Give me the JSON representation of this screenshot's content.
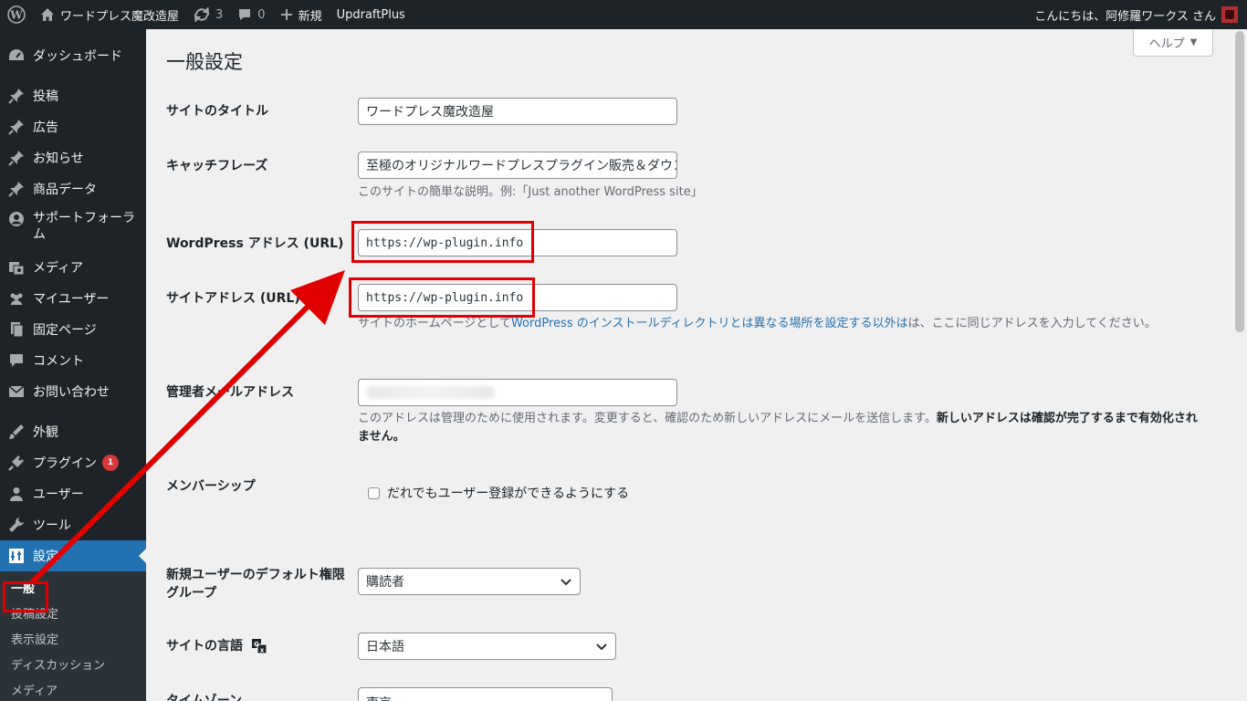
{
  "adminbar": {
    "site_name": "ワードプレス魔改造屋",
    "updates_count": "3",
    "comments_count": "0",
    "new_label": "新規",
    "plugin_label": "UpdraftPlus",
    "greeting": "こんにちは、阿修羅ワークス さん"
  },
  "sidebar": {
    "items": [
      {
        "label": "ダッシュボード",
        "icon": "dashboard-icon"
      },
      {
        "label": "投稿",
        "icon": "pin-icon"
      },
      {
        "label": "広告",
        "icon": "pin-icon"
      },
      {
        "label": "お知らせ",
        "icon": "pin-icon"
      },
      {
        "label": "商品データ",
        "icon": "pin-icon"
      },
      {
        "label": "サポートフォーラム",
        "icon": "support-icon"
      },
      {
        "label": "メディア",
        "icon": "media-icon"
      },
      {
        "label": "マイユーザー",
        "icon": "users-group-icon"
      },
      {
        "label": "固定ページ",
        "icon": "page-icon"
      },
      {
        "label": "コメント",
        "icon": "comment-icon"
      },
      {
        "label": "お問い合わせ",
        "icon": "mail-icon"
      },
      {
        "label": "外観",
        "icon": "appearance-icon"
      },
      {
        "label": "プラグイン",
        "icon": "plugin-icon",
        "badge": "1"
      },
      {
        "label": "ユーザー",
        "icon": "user-icon"
      },
      {
        "label": "ツール",
        "icon": "tools-icon"
      },
      {
        "label": "設定",
        "icon": "settings-icon"
      }
    ],
    "submenu": [
      "一般",
      "投稿設定",
      "表示設定",
      "ディスカッション",
      "メディア"
    ]
  },
  "main": {
    "title": "一般設定",
    "help_label": "ヘルプ",
    "fields": {
      "site_title_label": "サイトのタイトル",
      "site_title_value": "ワードプレス魔改造屋",
      "tagline_label": "キャッチフレーズ",
      "tagline_value": "至極のオリジナルワードプレスプラグイン販売＆ダウンロード",
      "tagline_desc": "このサイトの簡単な説明。例:「Just another WordPress site」",
      "wp_url_label": "WordPress アドレス (URL)",
      "wp_url_value": "https://wp-plugin.info",
      "site_url_label": "サイトアドレス (URL)",
      "site_url_value": "https://wp-plugin.info",
      "site_url_desc_pre": "サイトのホームページとして",
      "site_url_desc_link": "WordPress のインストールディレクトリとは異なる場所を設定する",
      "site_url_desc_mid": "以外は",
      "site_url_desc_post": "は、ここに同じアドレスを入力してください。",
      "admin_email_label": "管理者メールアドレス",
      "admin_email_desc": "このアドレスは管理のために使用されます。変更すると、確認のため新しいアドレスにメールを送信します。",
      "admin_email_desc_strong": "新しいアドレスは確認が完了するまで有効化されません。",
      "membership_label": "メンバーシップ",
      "membership_checkbox": "だれでもユーザー登録ができるようにする",
      "default_role_label": "新規ユーザーのデフォルト権限グループ",
      "default_role_value": "購読者",
      "language_label": "サイトの言語",
      "language_value": "日本語",
      "timezone_label": "タイムゾーン",
      "timezone_value": "東京"
    }
  },
  "colors": {
    "highlight_red": "#e00000",
    "admin_blue": "#2271b1",
    "admin_dark": "#1d2327"
  }
}
